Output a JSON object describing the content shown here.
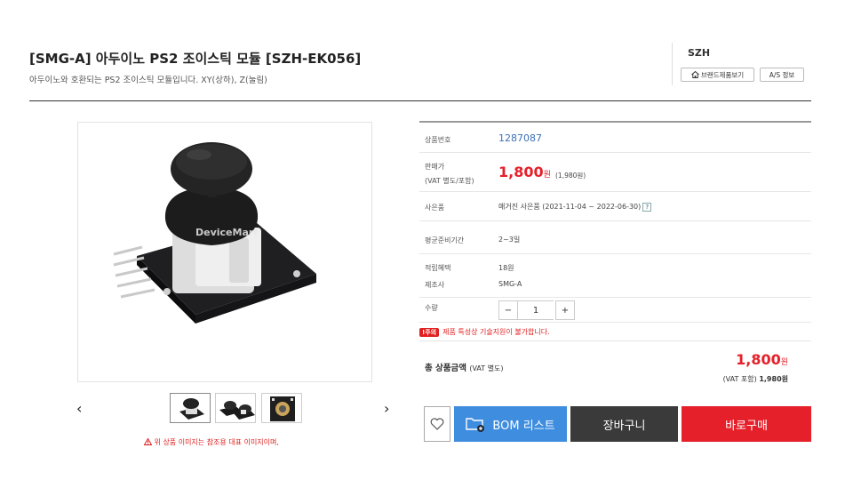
{
  "product": {
    "title": "[SMG-A] 아두이노 PS2 조이스틱 모듈 [SZH-EK056]",
    "subtitle": "아두이노와 호환되는 PS2 조이스틱 모듈입니다. XY(상하), Z(눌림)"
  },
  "brand": {
    "name": "SZH",
    "brand_products_label": "브랜드제품보기",
    "as_info_label": "A/S 정보"
  },
  "image": {
    "watermark": "DeviceMart",
    "notice": "위 상품 이미지는 참조용 대표 이미지이며,",
    "prev_arrow": "‹",
    "next_arrow": "›"
  },
  "info": {
    "product_code_label": "상품번호",
    "product_code": "1287087",
    "price_label": "판매가",
    "price_label_sub": "(VAT 별도/포함)",
    "price": "1,800",
    "price_unit": "원",
    "price_vat": "(1,980원)",
    "gift_label": "사은품",
    "gift_value": "매거진 사은품 (2021-11-04 ~ 2022-06-30)",
    "gift_help": "?",
    "lead_time_label": "평균준비기간",
    "lead_time_value": "2~3일",
    "points_label": "적립혜택",
    "points_value": "18원",
    "maker_label": "제조사",
    "maker_value": "SMG-A",
    "qty_label": "수량",
    "qty_minus": "−",
    "qty_value": "1",
    "qty_plus": "+",
    "warning_badge": "주의",
    "warning_text": "제품 특성상 기술지원이 불가합니다."
  },
  "total": {
    "label": "총 상품금액",
    "label_sub": "(VAT 별도)",
    "price": "1,800",
    "price_unit": "원",
    "vat_label": "(VAT 포함)",
    "vat_price": "1,980원"
  },
  "actions": {
    "bom_label": "BOM 리스트",
    "cart_label": "장바구니",
    "buy_label": "바로구매"
  }
}
